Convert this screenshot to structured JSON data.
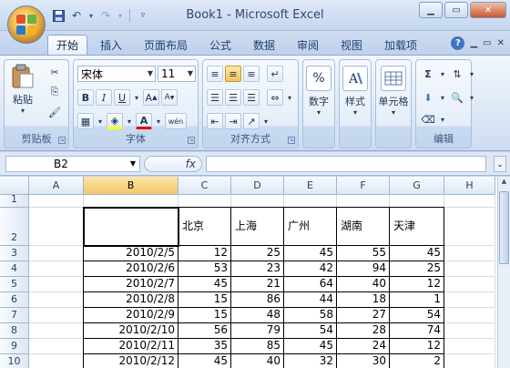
{
  "window": {
    "title": "Book1 - Microsoft Excel",
    "minimize": "▁",
    "maximize": "▭",
    "close": "✕"
  },
  "tabs": [
    {
      "label": "开始"
    },
    {
      "label": "插入"
    },
    {
      "label": "页面布局"
    },
    {
      "label": "公式"
    },
    {
      "label": "数据"
    },
    {
      "label": "审阅"
    },
    {
      "label": "视图"
    },
    {
      "label": "加载项"
    }
  ],
  "ribbon": {
    "clipboard": {
      "label": "剪贴板",
      "paste": "粘贴"
    },
    "font": {
      "label": "字体",
      "font_name": "宋体",
      "font_size": "11",
      "bold": "B",
      "italic": "I",
      "underline": "U",
      "font_color_letter": "A",
      "phonetic": "wén"
    },
    "alignment": {
      "label": "对齐方式"
    },
    "number": {
      "label": "数字",
      "icon_text": "%"
    },
    "styles": {
      "label": "样式"
    },
    "cells": {
      "label": "单元格"
    },
    "editing": {
      "label": "编辑",
      "sum": "Σ"
    }
  },
  "formula_bar": {
    "name_box": "B2",
    "fx": "fx",
    "formula": ""
  },
  "sheet": {
    "columns": [
      "A",
      "B",
      "C",
      "D",
      "E",
      "F",
      "G",
      "H"
    ],
    "selected_column": "B",
    "rows": [
      "1",
      "2",
      "3",
      "4",
      "5",
      "6",
      "7",
      "8",
      "9",
      "10"
    ],
    "header_row": [
      "",
      "北京",
      "上海",
      "广州",
      "湖南",
      "天津"
    ],
    "data_rows": [
      [
        "2010/2/5",
        "12",
        "25",
        "45",
        "55",
        "45"
      ],
      [
        "2010/2/6",
        "53",
        "23",
        "42",
        "94",
        "25"
      ],
      [
        "2010/2/7",
        "45",
        "21",
        "64",
        "40",
        "12"
      ],
      [
        "2010/2/8",
        "15",
        "86",
        "44",
        "18",
        "1"
      ],
      [
        "2010/2/9",
        "15",
        "48",
        "58",
        "27",
        "54"
      ],
      [
        "2010/2/10",
        "56",
        "79",
        "54",
        "28",
        "74"
      ],
      [
        "2010/2/11",
        "35",
        "85",
        "45",
        "24",
        "12"
      ],
      [
        "2010/2/12",
        "45",
        "40",
        "32",
        "30",
        "2"
      ]
    ]
  },
  "colors": {
    "accent": "#3f74c4",
    "selected_header": "#f3c86a",
    "ribbon_bg": "#dde8f6"
  }
}
